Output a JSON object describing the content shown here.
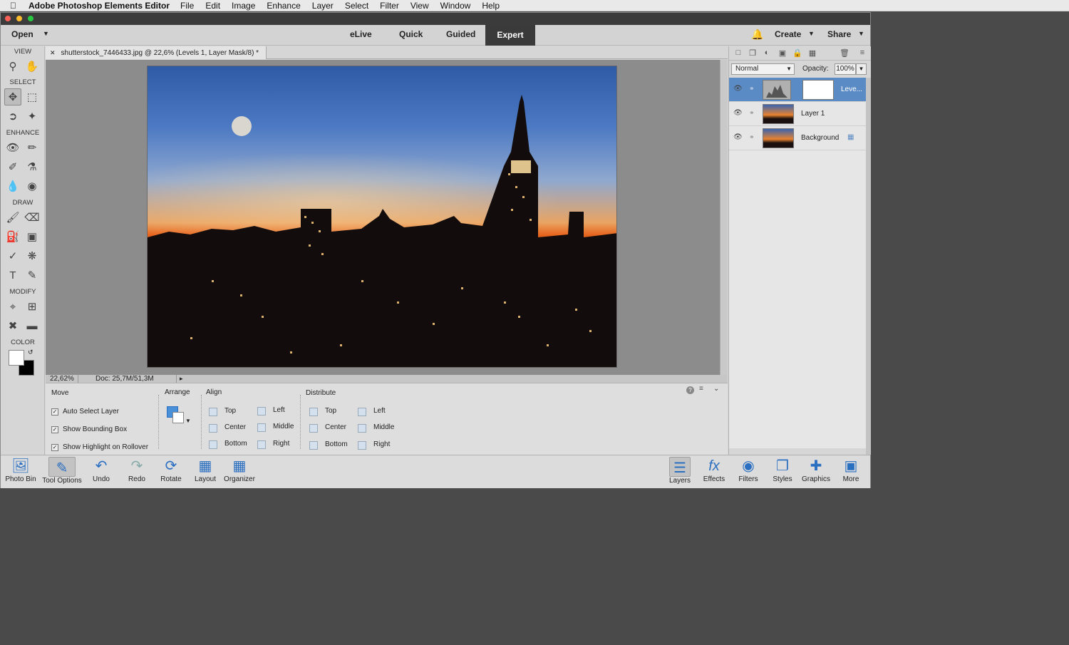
{
  "menubar": {
    "app": "Adobe Photoshop Elements Editor",
    "items": [
      "File",
      "Edit",
      "Image",
      "Enhance",
      "Layer",
      "Select",
      "Filter",
      "View",
      "Window",
      "Help"
    ]
  },
  "topbar": {
    "open": "Open",
    "modes": [
      "eLive",
      "Quick",
      "Guided",
      "Expert"
    ],
    "active_mode": "Expert",
    "create": "Create",
    "share": "Share"
  },
  "toolbox": {
    "sections": [
      "VIEW",
      "SELECT",
      "ENHANCE",
      "DRAW",
      "MODIFY",
      "COLOR"
    ]
  },
  "document": {
    "tab": "shutterstock_7446433.jpg @ 22,6% (Levels 1, Layer Mask/8) *",
    "zoom": "22,62%",
    "doc_size": "Doc: 25,7M/51,3M"
  },
  "options": {
    "move": "Move",
    "auto_select": "Auto Select Layer",
    "show_bbox": "Show Bounding Box",
    "show_highlight": "Show Highlight on Rollover",
    "arrange": "Arrange",
    "align": {
      "title": "Align",
      "top": "Top",
      "center": "Center",
      "bottom": "Bottom",
      "left": "Left",
      "middle": "Middle",
      "right": "Right"
    },
    "distribute": {
      "title": "Distribute",
      "top": "Top",
      "center": "Center",
      "bottom": "Bottom",
      "left": "Left",
      "middle": "Middle",
      "right": "Right"
    }
  },
  "layers": {
    "blend_mode": "Normal",
    "opacity_label": "Opacity:",
    "opacity": "100%",
    "items": [
      {
        "name": "Leve...",
        "selected": true
      },
      {
        "name": "Layer 1",
        "selected": false
      },
      {
        "name": "Background",
        "selected": false
      }
    ]
  },
  "bottombar": {
    "left": [
      {
        "label": "Photo Bin",
        "icon": "photo-bin-icon"
      },
      {
        "label": "Tool Options",
        "icon": "tool-options-icon"
      },
      {
        "label": "Undo",
        "icon": "undo-icon"
      },
      {
        "label": "Redo",
        "icon": "redo-icon"
      },
      {
        "label": "Rotate",
        "icon": "rotate-icon"
      },
      {
        "label": "Layout",
        "icon": "layout-icon"
      },
      {
        "label": "Organizer",
        "icon": "organizer-icon"
      }
    ],
    "right": [
      {
        "label": "Layers",
        "icon": "layers-icon"
      },
      {
        "label": "Effects",
        "icon": "effects-icon"
      },
      {
        "label": "Filters",
        "icon": "filters-icon"
      },
      {
        "label": "Styles",
        "icon": "styles-icon"
      },
      {
        "label": "Graphics",
        "icon": "graphics-icon"
      },
      {
        "label": "More",
        "icon": "more-icon"
      }
    ]
  },
  "colors": {
    "accent": "#5b8bc4",
    "expert_bg": "#3a3a3a",
    "desktop": "#4a4a4a"
  }
}
